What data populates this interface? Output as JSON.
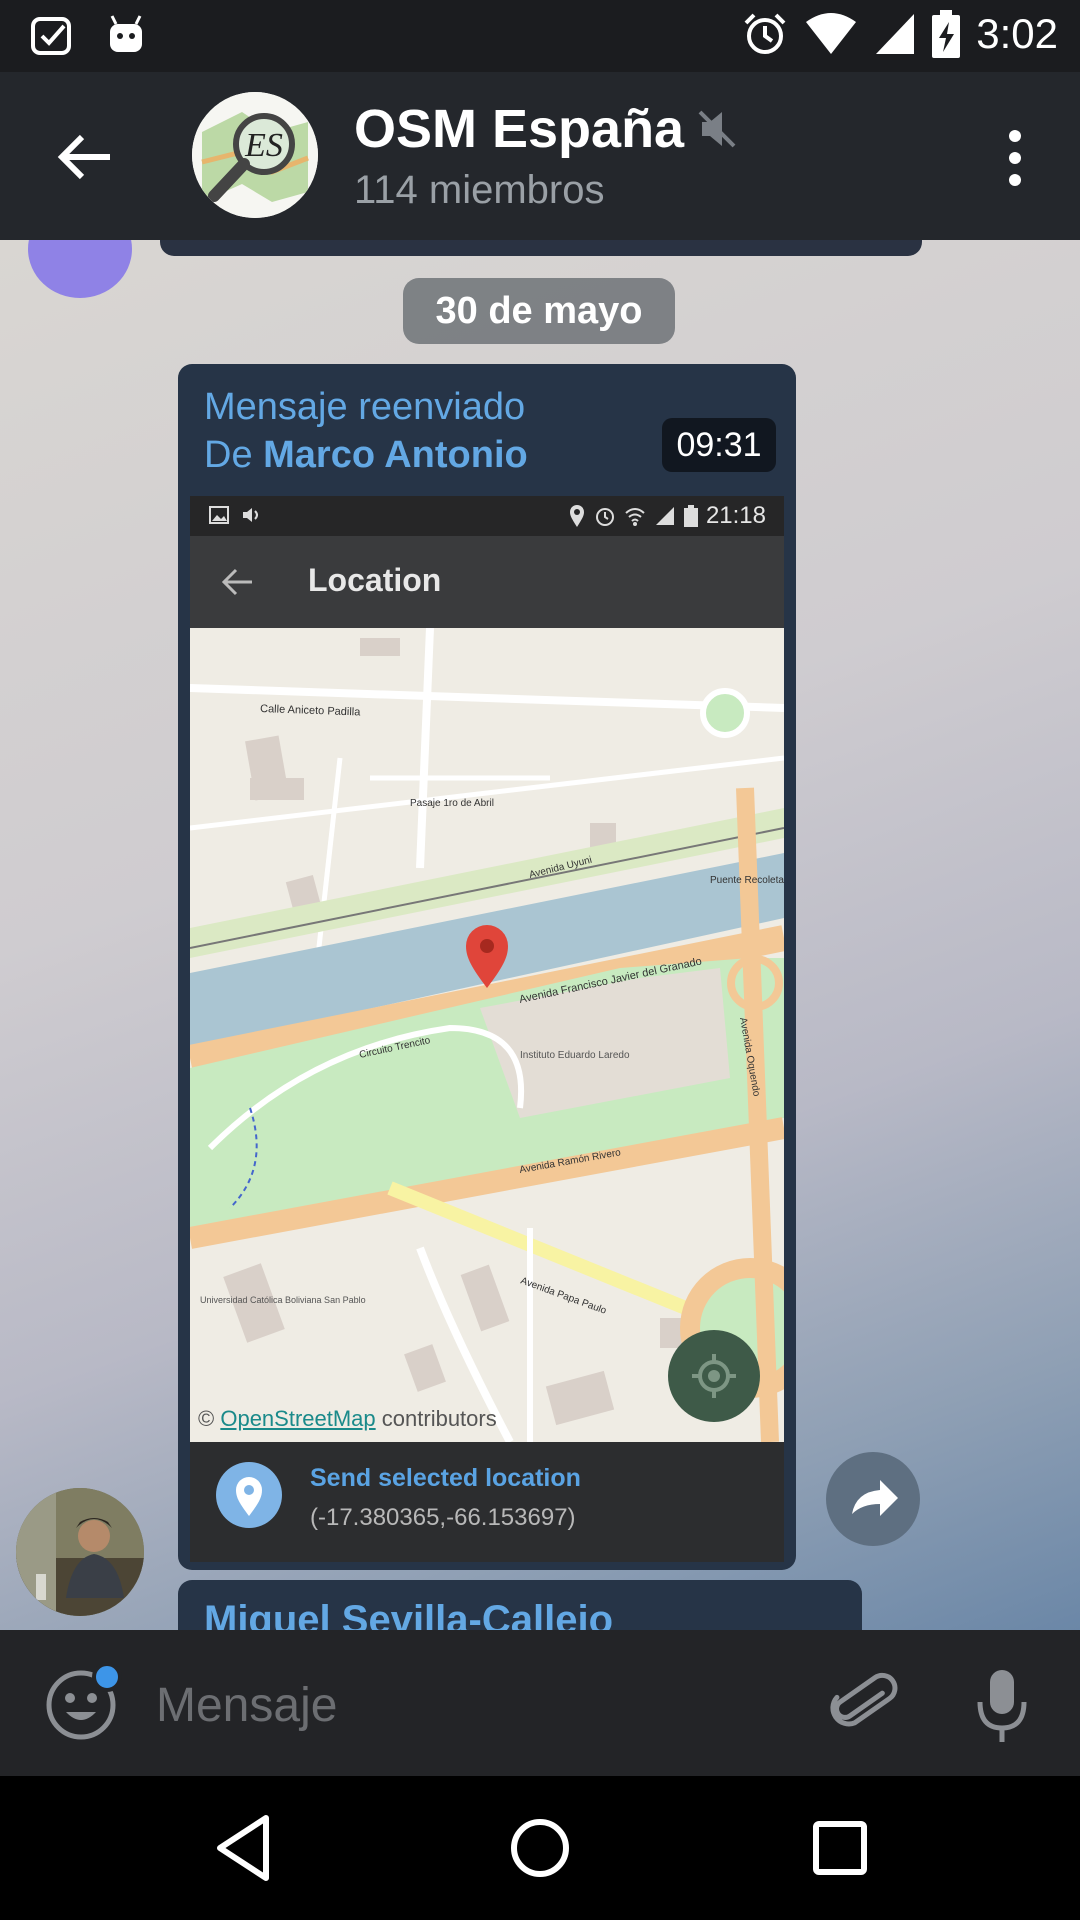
{
  "status_bar": {
    "time": "3:02",
    "icons": [
      "checklist-icon",
      "android-icon",
      "alarm-icon",
      "wifi-icon",
      "signal-icon",
      "battery-charging-icon"
    ]
  },
  "header": {
    "title": "OSM España",
    "members": "114 miembros",
    "avatar_text": "ES",
    "muted": true
  },
  "chat": {
    "date_chip": "30 de mayo",
    "message": {
      "forwarded_label": "Mensaje reenviado",
      "from_prefix": "De",
      "from_name": "Marco Antonio",
      "time": "09:31",
      "screenshot": {
        "status_time": "21:18",
        "toolbar_title": "Location",
        "map_attribution_prefix": "©",
        "map_attribution_link": "OpenStreetMap",
        "map_attribution_suffix": "contributors",
        "send_title": "Send selected location",
        "send_coords": "(-17.380365,-66.153697)",
        "map_labels": {
          "street_1": "Calle Aniceto Padilla",
          "street_2": "Avenida Francisco Javier del Granado",
          "street_3": "Avenida Ramón Rivero",
          "street_4": "Circuito Trencito",
          "street_5": "Avenida Uyuni",
          "street_6": "Avenida Papa Paulo",
          "street_7": "Avenida Oquendo",
          "place_1": "Puente Recoleta",
          "place_2": "Instituto Eduardo Laredo",
          "place_3": "Universidad Católica Boliviana San Pablo",
          "street_8": "Pasaje 1ro de Abril"
        }
      }
    },
    "next_sender": "Miguel Sevilla-Callejo"
  },
  "composer": {
    "placeholder": "Mensaje"
  },
  "colors": {
    "accent": "#63a8e4",
    "header_bg": "#24272c",
    "bubble_bg": "#263447"
  }
}
